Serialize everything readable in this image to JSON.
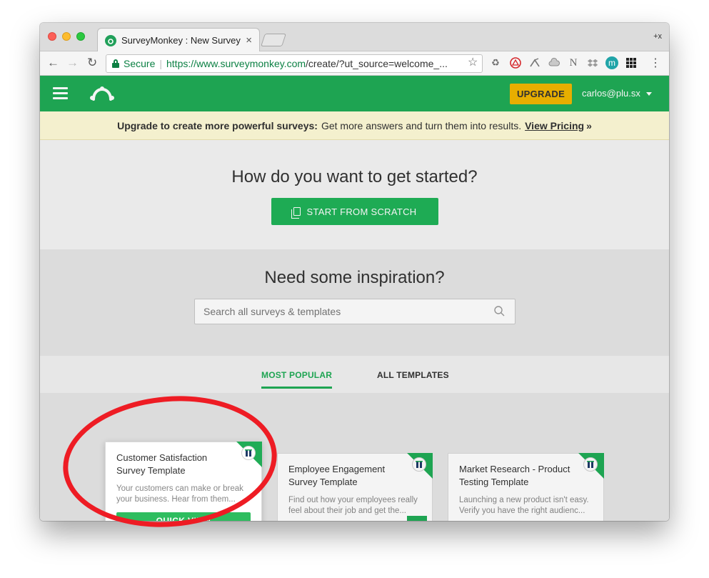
{
  "browser": {
    "tab_title": "SurveyMonkey : New Survey",
    "tab_close": "×",
    "new_tab_hint": "+x",
    "secure_label": "Secure",
    "url_scheme_host": "https://www.surveymonkey.com",
    "url_path": "/create/?ut_source=welcome_...",
    "star_icon": "star-icon",
    "extensions": [
      "recycle-icon",
      "acrobat-icon",
      "arrow-ext-icon",
      "cloud-icon",
      "n-ext-icon",
      "dropbox-icon",
      "m-avatar-icon",
      "grid-icon",
      "kebab-menu-icon"
    ],
    "m_avatar_letter": "m",
    "n_letter": "N"
  },
  "header": {
    "upgrade_label": "UPGRADE",
    "account_email": "carlos@plu.sx"
  },
  "banner": {
    "bold_text": "Upgrade to create more powerful surveys:",
    "text": "Get more answers and turn them into results.",
    "link_text": "View Pricing",
    "link_suffix": "»"
  },
  "start": {
    "heading": "How do you want to get started?",
    "scratch_button": "START FROM SCRATCH"
  },
  "inspiration": {
    "heading": "Need some inspiration?",
    "search_placeholder": "Search all surveys & templates"
  },
  "template_tabs": [
    {
      "label": "MOST POPULAR",
      "active": true
    },
    {
      "label": "ALL TEMPLATES",
      "active": false
    }
  ],
  "cards": [
    {
      "title": "Customer Satisfaction Survey Template",
      "description": "Your customers can make or break your business. Hear from them...",
      "button": "QUICK VIEW",
      "highlighted": true
    },
    {
      "title": "Employee Engagement Survey Template",
      "description": "Find out how your employees really feel about their job and get the..."
    },
    {
      "title": "Market Research - Product Testing Template",
      "description": "Launching a new product isn't easy. Verify you have the right audienc..."
    }
  ],
  "colors": {
    "brand_green": "#20ac56",
    "upgrade_yellow": "#f2b600",
    "banner_bg": "#fffbd8",
    "callout_red": "#ee1c24"
  }
}
